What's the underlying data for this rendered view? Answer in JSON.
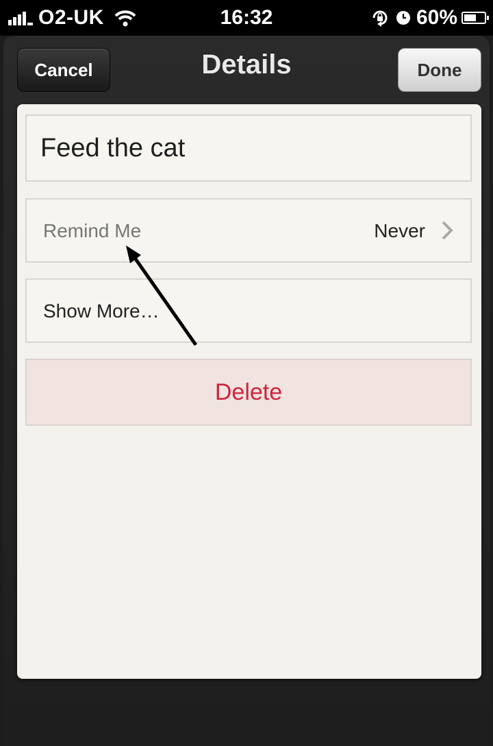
{
  "status_bar": {
    "carrier": "O2-UK",
    "time": "16:32",
    "battery_percent": "60%",
    "battery_level": 0.6,
    "icons": [
      "signal-icon",
      "wifi-icon",
      "rotation-lock-icon",
      "alarm-icon",
      "battery-icon"
    ]
  },
  "nav": {
    "cancel_label": "Cancel",
    "title": "Details",
    "done_label": "Done"
  },
  "task": {
    "title": "Feed the cat"
  },
  "remind": {
    "label": "Remind Me",
    "value": "Never"
  },
  "show_more": {
    "label": "Show More…"
  },
  "delete": {
    "label": "Delete"
  },
  "colors": {
    "delete_text": "#d0233a",
    "delete_bg": "#f0e3e0",
    "paper": "#f3f2ec",
    "annotation_arrow": "#000000"
  }
}
